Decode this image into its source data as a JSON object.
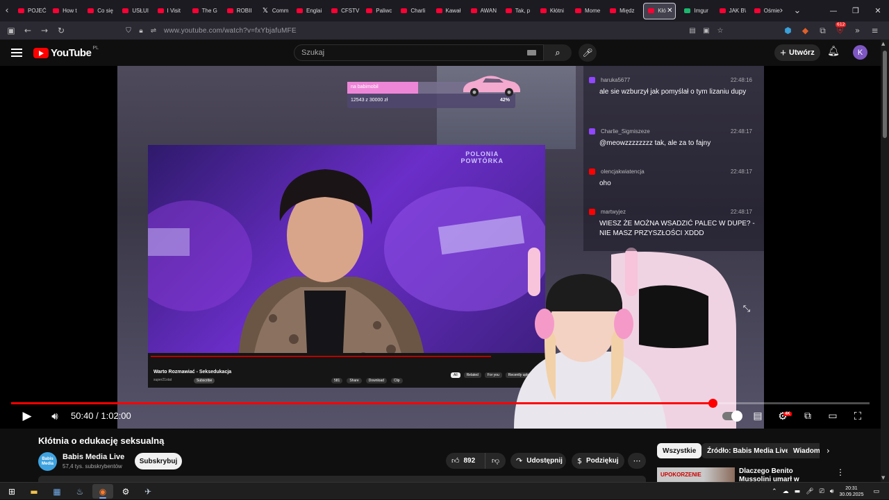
{
  "browser": {
    "tabs": [
      {
        "label": "POJEĆ",
        "icon": "youtube"
      },
      {
        "label": "How t",
        "icon": "youtube"
      },
      {
        "label": "Co się",
        "icon": "youtube"
      },
      {
        "label": "USŁUI",
        "icon": "youtube"
      },
      {
        "label": "I Visit",
        "icon": "youtube"
      },
      {
        "label": "The G",
        "icon": "youtube"
      },
      {
        "label": "ROBII",
        "icon": "youtube"
      },
      {
        "label": "Comm",
        "icon": "x"
      },
      {
        "label": "Englai",
        "icon": "youtube"
      },
      {
        "label": "CFSTV",
        "icon": "youtube"
      },
      {
        "label": "Paliwc",
        "icon": "youtube"
      },
      {
        "label": "Charli",
        "icon": "youtube"
      },
      {
        "label": "Kawał",
        "icon": "youtube"
      },
      {
        "label": "AWAN",
        "icon": "youtube"
      },
      {
        "label": "Tak, p",
        "icon": "youtube"
      },
      {
        "label": "Kłótni",
        "icon": "youtube"
      },
      {
        "label": "Mome",
        "icon": "youtube"
      },
      {
        "label": "Międz",
        "icon": "youtube"
      },
      {
        "label": "Kłó",
        "icon": "youtube",
        "active": true
      },
      {
        "label": "Imgur",
        "icon": "imgur"
      },
      {
        "label": "JAK B\\",
        "icon": "youtube"
      },
      {
        "label": "Ośmie",
        "icon": "youtube"
      }
    ],
    "url": "www.youtube.com/watch?v=fxYbjafuMFE",
    "extensions_badge": "612"
  },
  "youtube": {
    "logo_text": "YouTube",
    "country": "PL",
    "search_placeholder": "Szukaj",
    "create_label": "Utwórz",
    "avatar_letter": "K"
  },
  "overlay": {
    "donation_label": "na babimobil",
    "donation_amount": "12543 z 30000 zł",
    "donation_percent": "42%",
    "donation_fraction": 0.42,
    "inner_logo": "POLONIA\nPOWTÓRKA",
    "inner_title": "Warto Rozmawiać - Seksedukacja",
    "inner_channel": "super21stat",
    "inner_subscribe": "Subscribe",
    "inner_actions": [
      "581",
      "Share",
      "Download",
      "Clip"
    ],
    "inner_tabs": [
      "All",
      "Related",
      "For you",
      "Recently uploaded"
    ]
  },
  "chat": [
    {
      "user": "haruka5677",
      "time": "22:48:16",
      "platform": "twitch",
      "text": "ale sie wzburzył jak pomyślał o tym lizaniu dupy"
    },
    {
      "user": "Charlie_Sigmiszeze",
      "time": "22:48:17",
      "platform": "twitch",
      "text": "@meowzzzzzzzz tak, ale za to fajny"
    },
    {
      "user": "olencjakwiatencja",
      "time": "22:48:17",
      "platform": "youtube",
      "text": "oho"
    },
    {
      "user": "martwyjez",
      "time": "22:48:17",
      "platform": "youtube",
      "text": "WIESZ ŻE MOŻNA WSADZIĆ PALEC W DUPE? - NIE MASZ PRZYSZŁOŚCI XDDD"
    }
  ],
  "player": {
    "time_current": "50:40",
    "time_total": "1:02:00",
    "progress_fraction": 0.817,
    "quality_badge": "4K"
  },
  "video": {
    "title": "Kłótnia o edukację seksualną",
    "channel_name": "Babis Media Live",
    "channel_avatar_text": "Babis Media",
    "subscribers": "57,4 tys. subskrybentów",
    "subscribe_label": "Subskrybuj",
    "likes": "892",
    "share_label": "Udostępnij",
    "thanks_label": "Podziękuj"
  },
  "chips": [
    "Wszystkie",
    "Źródło: Babis Media Live",
    "Wiadomości"
  ],
  "recommendation": {
    "thumb_text": "UPOKORZENIE",
    "title": "Dlaczego Benito Mussolini umarł w najgorszy możliwy"
  },
  "taskbar": {
    "time": "20:31",
    "date": "30.09.2025"
  }
}
